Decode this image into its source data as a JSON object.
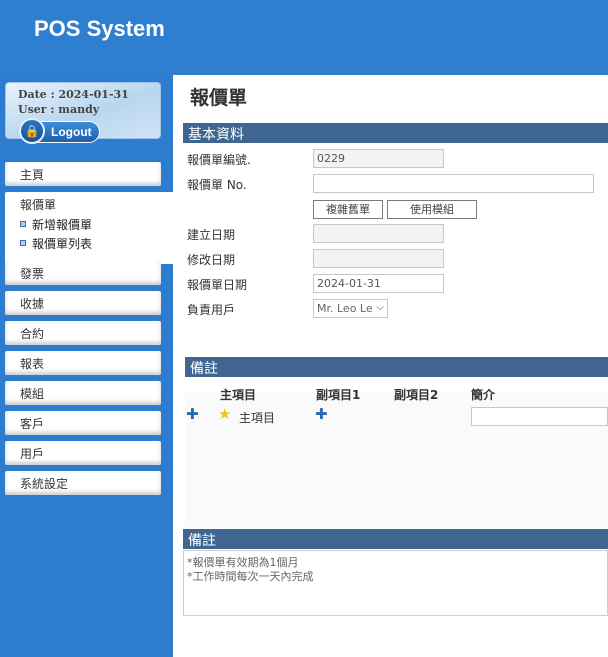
{
  "header": {
    "app_title": "POS System"
  },
  "user_box": {
    "date_line": "Date : 2024-01-31",
    "user_line": "User : mandy",
    "logout_label": "Logout"
  },
  "sidebar": {
    "items": [
      {
        "label": "主頁"
      },
      {
        "label": "報價單",
        "children": [
          "新增報價單",
          "報價單列表"
        ]
      },
      {
        "label": "發票"
      },
      {
        "label": "收據"
      },
      {
        "label": "合約"
      },
      {
        "label": "報表"
      },
      {
        "label": "模組"
      },
      {
        "label": "客戶"
      },
      {
        "label": "用戶"
      },
      {
        "label": "系統設定"
      }
    ]
  },
  "main": {
    "page_title": "報價單",
    "basic_section": {
      "title": "基本資料",
      "fields": {
        "quote_id_label": "報價單編號.",
        "quote_id_value": "0229",
        "quote_no_label": "報價單 No.",
        "quote_no_value": "",
        "copy_button": "複雜舊單",
        "template_button": "使用模組",
        "created_label": "建立日期",
        "created_value": "",
        "modified_label": "修改日期",
        "modified_value": "",
        "quote_date_label": "報價單日期",
        "quote_date_value": "2024-01-31",
        "owner_label": "負責用戶",
        "owner_value": "Mr. Leo Le"
      }
    },
    "items_section": {
      "title": "備註",
      "columns": [
        "主項目",
        "副項目1",
        "副項目2",
        "簡介"
      ],
      "row": {
        "main_item": "主項目"
      }
    },
    "remarks_section": {
      "title": "備註",
      "lines": [
        "*報價單有效期為1個月",
        "*工作時間每次一天內完成"
      ]
    }
  },
  "colors": {
    "header_blue": "#2f7fd0",
    "section_bar": "#3f6690",
    "accent": "#2f66b2"
  }
}
